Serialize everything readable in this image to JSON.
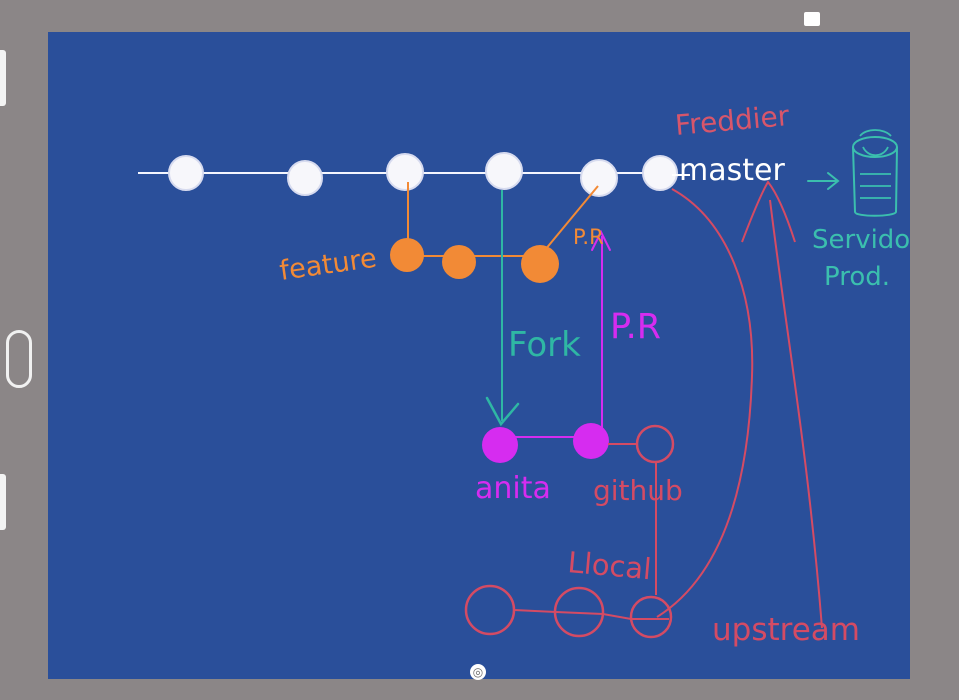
{
  "labels": {
    "freddier": "Freddier",
    "master": "master",
    "feature": "feature",
    "pr_top": "P.R",
    "fork": "Fork",
    "pr_vertical": "P.R",
    "anita": "anita",
    "github": "github",
    "local": "Llocal",
    "upstream": "upstream",
    "servidor": "Servidor",
    "prod": "Prod."
  },
  "colors": {
    "canvas": "#2a4f9a",
    "master_line": "#f4f6ff",
    "commit_white": "#f7f7fb",
    "feature_orange": "#f28a36",
    "fork_teal": "#2fb7a4",
    "purple": "#d62cf0",
    "red_upstream": "#d44b64",
    "freddier_red": "#d7566b",
    "server_teal": "#3bbfae"
  },
  "icons": {
    "status": "window-status-icon",
    "handle": "drag-handle-icon"
  }
}
